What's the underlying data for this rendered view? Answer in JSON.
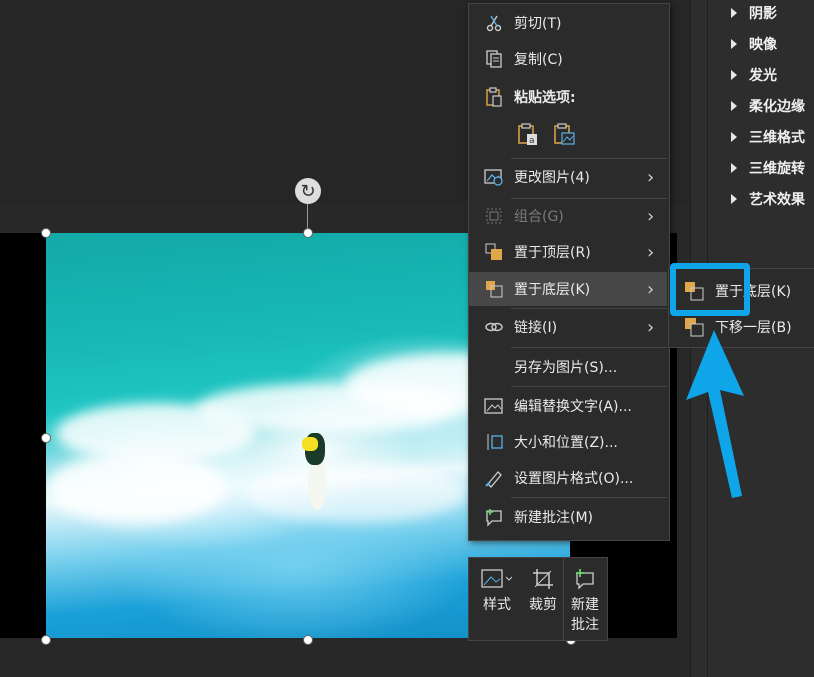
{
  "context_menu": {
    "items": [
      {
        "label": "剪切(T)",
        "icon": "scissors-icon"
      },
      {
        "label": "复制(C)",
        "icon": "copy-icon"
      },
      {
        "label": "粘贴选项:",
        "icon": "paste-icon"
      },
      {
        "label": "更改图片(4)",
        "icon": "change-picture-icon"
      },
      {
        "label": "组合(G)",
        "icon": "group-icon"
      },
      {
        "label": "置于顶层(R)",
        "icon": "bring-to-front-icon"
      },
      {
        "label": "置于底层(K)",
        "icon": "send-to-back-icon"
      },
      {
        "label": "链接(I)",
        "icon": "link-icon"
      },
      {
        "label": "另存为图片(S)...",
        "icon": ""
      },
      {
        "label": "编辑替换文字(A)...",
        "icon": "alt-text-icon"
      },
      {
        "label": "大小和位置(Z)...",
        "icon": "size-position-icon"
      },
      {
        "label": "设置图片格式(O)...",
        "icon": "format-picture-icon"
      },
      {
        "label": "新建批注(M)",
        "icon": "new-comment-icon"
      }
    ]
  },
  "submenu": {
    "items": [
      {
        "label": "置于底层(K)",
        "icon": "send-to-back-icon"
      },
      {
        "label": "下移一层(B)",
        "icon": "send-backward-icon"
      }
    ]
  },
  "right_panel": {
    "items": [
      "阴影",
      "映像",
      "发光",
      "柔化边缘",
      "三维格式",
      "三维旋转",
      "艺术效果"
    ]
  },
  "mini_toolbar": {
    "style_label": "样式",
    "crop_label": "裁剪",
    "comment_label_1": "新建",
    "comment_label_2": "批注"
  },
  "colors": {
    "accent": "#0ea5e9",
    "menu_bg": "#2b2b2b",
    "hover_bg": "#474747"
  }
}
